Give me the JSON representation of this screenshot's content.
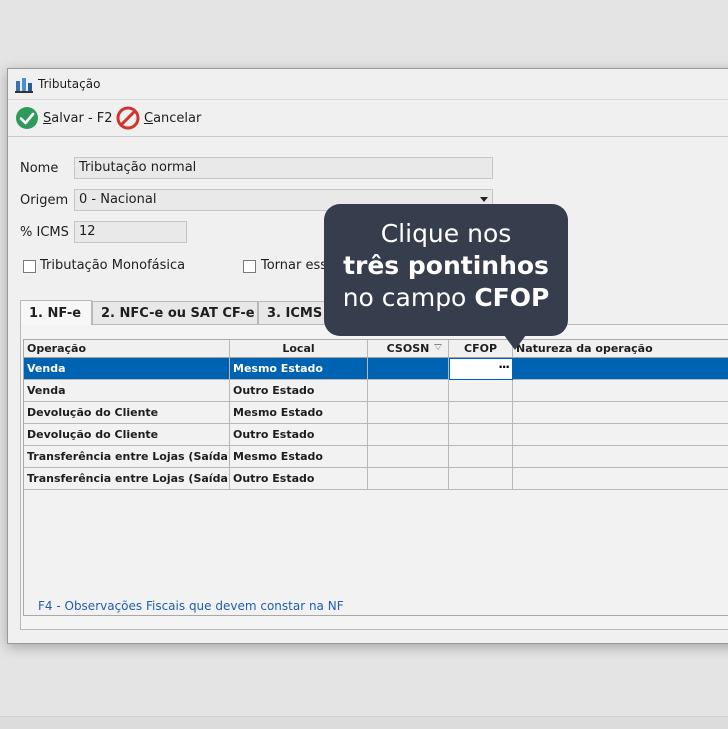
{
  "window": {
    "title": "Tributação",
    "icon": "tax-app-icon"
  },
  "toolbar": {
    "save_label_underlined": "S",
    "save_label_rest": "alvar - F2",
    "cancel_label_underlined": "C",
    "cancel_label_rest": "ancelar"
  },
  "form": {
    "nome_label": "Nome",
    "nome_value": "Tributação normal",
    "origem_label": "Origem",
    "origem_value": "0 - Nacional",
    "icms_label": "% ICMS",
    "icms_value": "12",
    "monofasica_label": "Tributação Monofásica",
    "tornar_label": "Tornar essa"
  },
  "tabs": [
    {
      "label": "1. NF-e",
      "active": true
    },
    {
      "label": "2. NFC-e ou SAT CF-e",
      "active": false
    },
    {
      "label": "3. ICMS S",
      "active": false
    }
  ],
  "grid": {
    "headers": {
      "operacao": "Operação",
      "local": "Local",
      "csosn": "CSOSN",
      "cfop": "CFOP",
      "natureza": "Natureza da operação"
    },
    "rows": [
      {
        "operacao": "Venda",
        "local": "Mesmo Estado",
        "selected": true
      },
      {
        "operacao": "Venda",
        "local": "Outro Estado",
        "selected": false
      },
      {
        "operacao": "Devolução do Cliente",
        "local": "Mesmo Estado",
        "selected": false
      },
      {
        "operacao": "Devolução do Cliente",
        "local": "Outro Estado",
        "selected": false
      },
      {
        "operacao": "Transferência entre Lojas (Saída)",
        "local": "Mesmo Estado",
        "selected": false
      },
      {
        "operacao": "Transferência entre Lojas (Saída)",
        "local": "Outro Estado",
        "selected": false
      }
    ],
    "dots_button": "···",
    "footer": "F4 - Observações Fiscais que devem constar na NF"
  },
  "tooltip": {
    "line1": "Clique nos",
    "line2": "três pontinhos",
    "line3_prefix": "no campo ",
    "line3_bold": "CFOP"
  },
  "colors": {
    "selection": "#0063b1",
    "tooltip_bg": "#363e4d",
    "save_green": "#2e9b5b",
    "cancel_red": "#d0342c",
    "footer_link": "#1f5fb0"
  }
}
